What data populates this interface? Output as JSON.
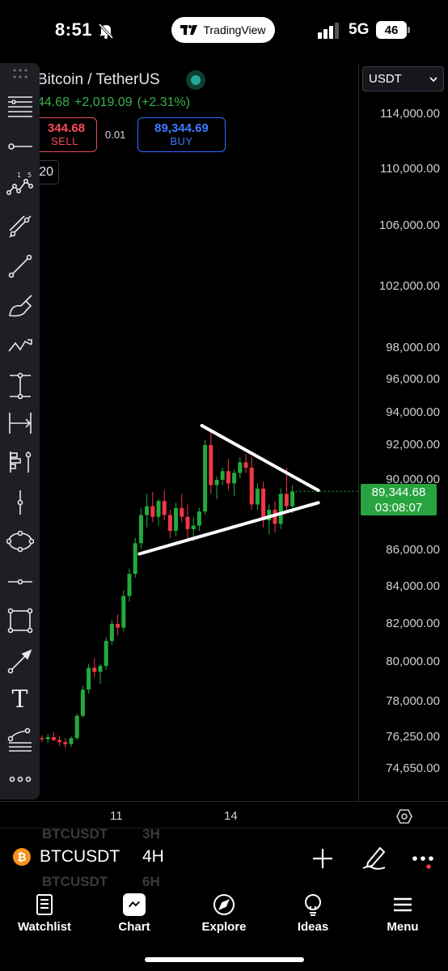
{
  "status_bar": {
    "time": "8:51",
    "app_pill": "TradingView",
    "network": "5G",
    "battery": "46"
  },
  "header": {
    "symbol_name": "Bitcoin / TetherUS",
    "ohlc_last": "44.68",
    "change": "+2,019.09",
    "change_pct": "(+2.31%)",
    "sell_price": "344.68",
    "sell_label": "SELL",
    "spread": "0.01",
    "buy_price": "89,344.69",
    "buy_label": "BUY",
    "quantity": "20"
  },
  "price_axis": {
    "currency": "USDT",
    "labels": [
      "114,000.00",
      "110,000.00",
      "106,000.00",
      "102,000.00",
      "98,000.00",
      "96,000.00",
      "94,000.00",
      "92,000.00",
      "90,000.00",
      "86,000.00",
      "84,000.00",
      "82,000.00",
      "80,000.00",
      "78,000.00",
      "76,250.00",
      "74,650.00"
    ],
    "last_price": "89,344.68",
    "countdown": "03:08:07"
  },
  "time_axis": {
    "labels": [
      "11",
      "14"
    ]
  },
  "chart_data": {
    "type": "candlestick",
    "symbol": "BTCUSDT",
    "interval": "4H",
    "last_price": 89344.68,
    "price_axis_ticks": [
      114000,
      110000,
      106000,
      102000,
      98000,
      96000,
      94000,
      92000,
      90000,
      86000,
      84000,
      82000,
      80000,
      78000,
      76250,
      74650
    ],
    "time_ticks": [
      "11",
      "14"
    ],
    "candles": [
      {
        "o": 76200,
        "h": 76350,
        "l": 76000,
        "c": 76150
      },
      {
        "o": 76150,
        "h": 76400,
        "l": 75950,
        "c": 76250
      },
      {
        "o": 76250,
        "h": 76500,
        "l": 76050,
        "c": 76100
      },
      {
        "o": 76100,
        "h": 76300,
        "l": 75800,
        "c": 76000
      },
      {
        "o": 76000,
        "h": 76200,
        "l": 75700,
        "c": 75900
      },
      {
        "o": 75900,
        "h": 76300,
        "l": 75750,
        "c": 76200
      },
      {
        "o": 76200,
        "h": 77400,
        "l": 76100,
        "c": 77300
      },
      {
        "o": 77300,
        "h": 78800,
        "l": 77200,
        "c": 78600
      },
      {
        "o": 78600,
        "h": 79900,
        "l": 78400,
        "c": 79700
      },
      {
        "o": 79700,
        "h": 80200,
        "l": 79200,
        "c": 79500
      },
      {
        "o": 79500,
        "h": 79900,
        "l": 78900,
        "c": 79800
      },
      {
        "o": 79800,
        "h": 81300,
        "l": 79600,
        "c": 81100
      },
      {
        "o": 81100,
        "h": 82200,
        "l": 80900,
        "c": 82000
      },
      {
        "o": 82000,
        "h": 82500,
        "l": 81400,
        "c": 81800
      },
      {
        "o": 81800,
        "h": 83800,
        "l": 81600,
        "c": 83500
      },
      {
        "o": 83500,
        "h": 85000,
        "l": 83200,
        "c": 84700
      },
      {
        "o": 84700,
        "h": 86700,
        "l": 84500,
        "c": 86400
      },
      {
        "o": 86400,
        "h": 88400,
        "l": 86100,
        "c": 88000
      },
      {
        "o": 88000,
        "h": 89200,
        "l": 87300,
        "c": 88500
      },
      {
        "o": 88500,
        "h": 89300,
        "l": 87600,
        "c": 87900
      },
      {
        "o": 87900,
        "h": 88900,
        "l": 87400,
        "c": 88800
      },
      {
        "o": 88800,
        "h": 89400,
        "l": 87700,
        "c": 88000
      },
      {
        "o": 88000,
        "h": 88300,
        "l": 86700,
        "c": 87100
      },
      {
        "o": 87100,
        "h": 88700,
        "l": 86800,
        "c": 88400
      },
      {
        "o": 88400,
        "h": 89200,
        "l": 87600,
        "c": 87900
      },
      {
        "o": 87900,
        "h": 88600,
        "l": 86600,
        "c": 87200
      },
      {
        "o": 87200,
        "h": 87900,
        "l": 86500,
        "c": 87400
      },
      {
        "o": 87400,
        "h": 88400,
        "l": 87100,
        "c": 88200
      },
      {
        "o": 88200,
        "h": 92300,
        "l": 88000,
        "c": 92000
      },
      {
        "o": 92000,
        "h": 92800,
        "l": 89200,
        "c": 89700
      },
      {
        "o": 89700,
        "h": 90200,
        "l": 88900,
        "c": 90000
      },
      {
        "o": 90000,
        "h": 90700,
        "l": 89700,
        "c": 90500
      },
      {
        "o": 90500,
        "h": 91200,
        "l": 89400,
        "c": 89800
      },
      {
        "o": 89800,
        "h": 90600,
        "l": 89100,
        "c": 90400
      },
      {
        "o": 90400,
        "h": 91300,
        "l": 90100,
        "c": 91000
      },
      {
        "o": 91000,
        "h": 91500,
        "l": 90400,
        "c": 90700
      },
      {
        "o": 90700,
        "h": 91300,
        "l": 88300,
        "c": 88600
      },
      {
        "o": 88600,
        "h": 89800,
        "l": 88300,
        "c": 89500
      },
      {
        "o": 89500,
        "h": 89900,
        "l": 87300,
        "c": 87700
      },
      {
        "o": 87700,
        "h": 88600,
        "l": 86900,
        "c": 88300
      },
      {
        "o": 88300,
        "h": 88800,
        "l": 87000,
        "c": 87500
      },
      {
        "o": 87500,
        "h": 89500,
        "l": 87200,
        "c": 89200
      },
      {
        "o": 89200,
        "h": 90700,
        "l": 88300,
        "c": 88500
      },
      {
        "o": 88500,
        "h": 89700,
        "l": 88100,
        "c": 89344.68
      }
    ],
    "annotations": [
      {
        "type": "trendline",
        "label": "triangle upper",
        "from": 93200,
        "to": 89400
      },
      {
        "type": "trendline",
        "label": "triangle lower",
        "from": 85800,
        "to": 88700
      }
    ]
  },
  "toolbar": {
    "tools": [
      "grip-icon",
      "horizontal-lines-icon",
      "horizontal-ray-icon",
      "elliott-wave-icon",
      "trend-line-icon",
      "line-icon",
      "brush-icon",
      "zigzag-icon",
      "vertical-range-icon",
      "date-range-icon",
      "long-position-icon",
      "price-note-icon",
      "ellipse-icon",
      "horizontal-line-icon",
      "rectangle-icon",
      "arrow-icon",
      "text-icon",
      "fib-icon",
      "more-icon"
    ],
    "text_tool": "T",
    "wave_numbers": [
      "1",
      "5"
    ]
  },
  "symbol_bar": {
    "symbol": "BTCUSDT",
    "interval": "4H",
    "ghost_prev_symbol": "BTCUSDT",
    "ghost_prev_interval": "3H",
    "ghost_next_symbol": "BTCUSDT",
    "ghost_next_interval": "6H"
  },
  "bottom_nav": [
    {
      "label": "Watchlist",
      "icon": "watchlist-icon"
    },
    {
      "label": "Chart",
      "icon": "chart-icon"
    },
    {
      "label": "Explore",
      "icon": "compass-icon"
    },
    {
      "label": "Ideas",
      "icon": "bulb-icon"
    },
    {
      "label": "Menu",
      "icon": "menu-icon"
    }
  ],
  "colors": {
    "up": "#22ab3a",
    "down": "#f23645",
    "buy": "#2962ff",
    "sell": "#f23645",
    "accent": "#089981",
    "price_tag": "#27a33f"
  }
}
